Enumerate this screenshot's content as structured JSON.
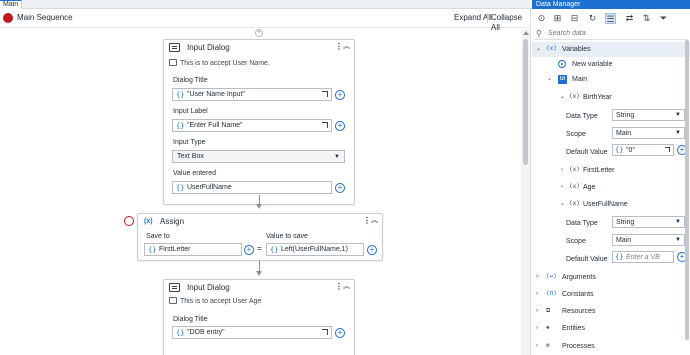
{
  "tab": {
    "label": "Main"
  },
  "breadcrumb": {
    "sequence": "Main Sequence",
    "expand_all": "Expand All",
    "collapse_all": "Collapse All"
  },
  "add_icon": "+",
  "activities": {
    "input_dialog_1": {
      "title": "Input Dialog",
      "annotation": "This is to accept User Name.",
      "dialog_title_label": "Dialog Title",
      "dialog_title_value": "\"User Name Input\"",
      "input_label_label": "Input Label",
      "input_label_value": "\"Enter Full Name\"",
      "input_type_label": "Input Type",
      "input_type_value": "Text Box",
      "value_entered_label": "Value entered",
      "value_entered_value": "UserFullName"
    },
    "assign": {
      "title": "Assign",
      "icon_text": "(x)",
      "save_to_label": "Save to",
      "save_to_value": "FirstLetter",
      "value_to_save_label": "Value to save",
      "value_to_save_value": "Left(UserFullName,1)",
      "equals": "="
    },
    "input_dialog_2": {
      "title": "Input Dialog",
      "annotation": "This is to accept User Age",
      "dialog_title_label": "Dialog Title",
      "dialog_title_value": "\"DOB entry\""
    }
  },
  "data_manager": {
    "title": "Data Manager",
    "search_placeholder": "Search data",
    "toolbar_icons": [
      "target-icon",
      "expand-icon",
      "collapse-icon",
      "refresh-icon",
      "list-view-icon",
      "swap-icon",
      "sort-icon",
      "filter-icon"
    ],
    "tree": {
      "variables": "Variables",
      "variables_icon": "(x)",
      "new_variable": "New variable",
      "main": "Main",
      "main_badge": "Ui",
      "birthyear": {
        "name": "BirthYear",
        "data_type_label": "Data Type",
        "data_type_value": "String",
        "scope_label": "Scope",
        "scope_value": "Main",
        "default_label": "Default Value",
        "default_value": "\"0\""
      },
      "first_letter": "FirstLetter",
      "age": "Age",
      "user_full_name": {
        "name": "UserFullName",
        "data_type_label": "Data Type",
        "data_type_value": "String",
        "scope_label": "Scope",
        "scope_value": "Main",
        "default_label": "Default Value",
        "default_placeholder": "Enter a VB"
      },
      "arguments": "Arguments",
      "constants": "Constants",
      "resources": "Resources",
      "entities": "Entities",
      "processes": "Processes"
    }
  },
  "colors": {
    "accent": "#1d6fd1",
    "breakpoint": "#c4161c"
  }
}
